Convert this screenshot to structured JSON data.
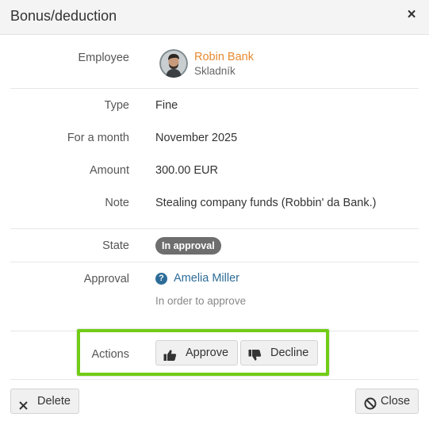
{
  "dialog": {
    "title": "Bonus/deduction"
  },
  "employee": {
    "label": "Employee",
    "name": "Robin Bank",
    "role": "Skladník"
  },
  "details": {
    "type_label": "Type",
    "type_value": "Fine",
    "month_label": "For a month",
    "month_value": "November 2025",
    "amount_label": "Amount",
    "amount_value": "300.00 EUR",
    "note_label": "Note",
    "note_value": "Stealing company funds (Robbin' da Bank.)"
  },
  "state": {
    "label": "State",
    "badge": "In approval",
    "badge_color": "#6e6e6e"
  },
  "approval": {
    "label": "Approval",
    "approver": "Amelia Miller",
    "note": "In order to approve",
    "icon": "question-icon"
  },
  "actions": {
    "label": "Actions",
    "approve_label": "Approve",
    "decline_label": "Decline",
    "highlight_color": "#71cc16"
  },
  "footer": {
    "delete_label": "Delete",
    "close_label": "Close"
  },
  "colors": {
    "employee_link": "#e6892f",
    "approver_link": "#2d6c98"
  }
}
